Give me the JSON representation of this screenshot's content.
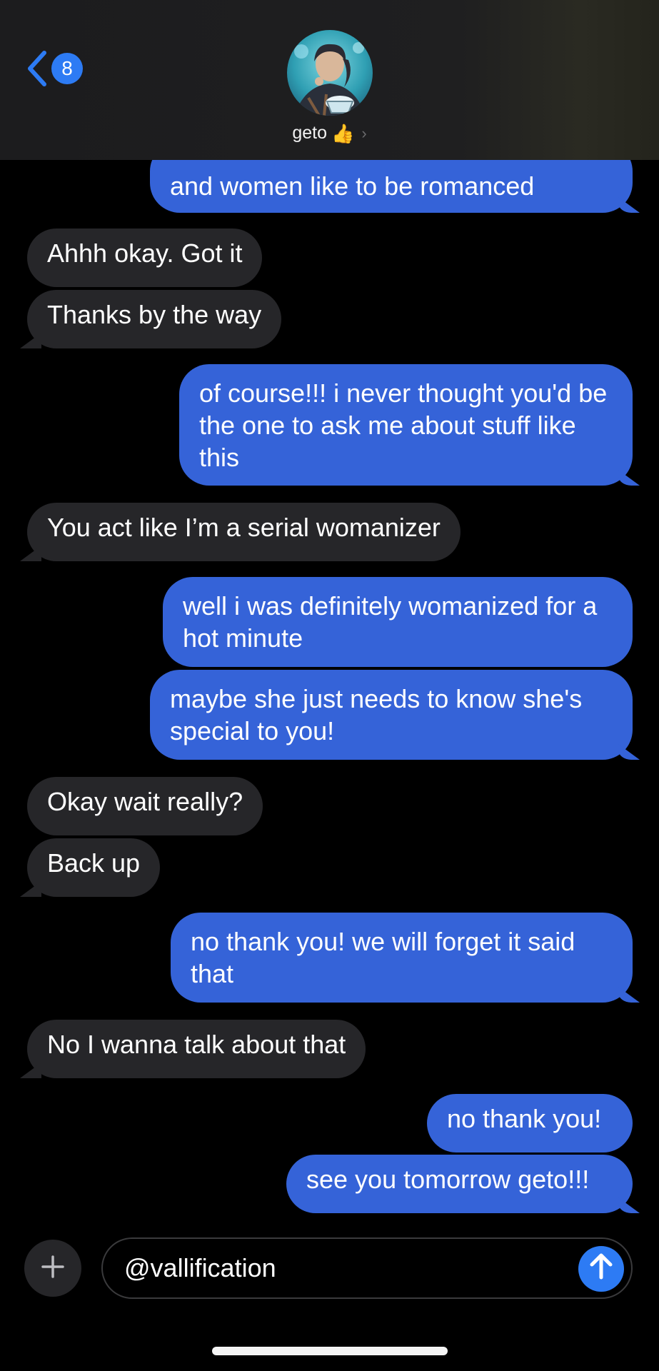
{
  "header": {
    "unread_count": "8",
    "contact_name": "geto",
    "contact_emoji": "👍"
  },
  "messages": [
    {
      "sender": "me",
      "text": "and women like to be romanced"
    },
    {
      "sender": "them",
      "text": "Ahhh okay. Got it"
    },
    {
      "sender": "them",
      "text": "Thanks by the way"
    },
    {
      "sender": "me",
      "text": "of course!!! i never thought you'd be the one to ask me about stuff like this"
    },
    {
      "sender": "them",
      "text": "You act like I’m a serial womanizer"
    },
    {
      "sender": "me",
      "text": "well i was definitely womanized for a hot minute"
    },
    {
      "sender": "me",
      "text": "maybe she just needs to know she's special to you!"
    },
    {
      "sender": "them",
      "text": "Okay wait really?"
    },
    {
      "sender": "them",
      "text": "Back up"
    },
    {
      "sender": "me",
      "text": "no thank you! we will forget it said that"
    },
    {
      "sender": "them",
      "text": "No I wanna talk about that"
    },
    {
      "sender": "me",
      "text": "no thank you!"
    },
    {
      "sender": "me",
      "text": "see you tomorrow geto!!!"
    }
  ],
  "composer": {
    "input_value": "@vallification"
  },
  "colors": {
    "outgoing_bubble": "#3563d8",
    "incoming_bubble": "#262629",
    "accent": "#2d7bf4"
  }
}
